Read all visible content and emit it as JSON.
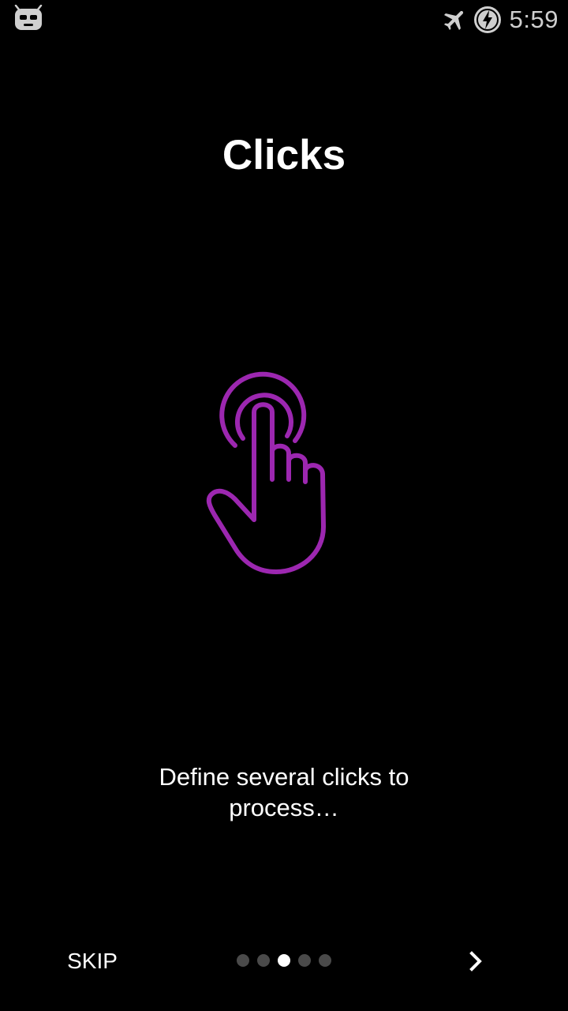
{
  "status_bar": {
    "left_icon": "cyanogenmod-mascot-icon",
    "airplane_icon": "airplane-mode-icon",
    "battery_icon": "battery-charging-icon",
    "time": "5:59"
  },
  "intro": {
    "title": "Clicks",
    "hero_icon": "tap-hand-icon",
    "description": "Define several clicks to process…"
  },
  "navigation": {
    "skip_label": "SKIP",
    "next_icon": "chevron-right-icon",
    "pages": [
      {
        "active": false
      },
      {
        "active": false
      },
      {
        "active": true
      },
      {
        "active": false
      },
      {
        "active": false
      }
    ]
  },
  "colors": {
    "background": "#000000",
    "accent": "#9c27b0",
    "text": "#ffffff",
    "status_icons": "#cfcfcf",
    "dot_inactive": "#4a4a4a",
    "dot_active": "#ffffff"
  }
}
